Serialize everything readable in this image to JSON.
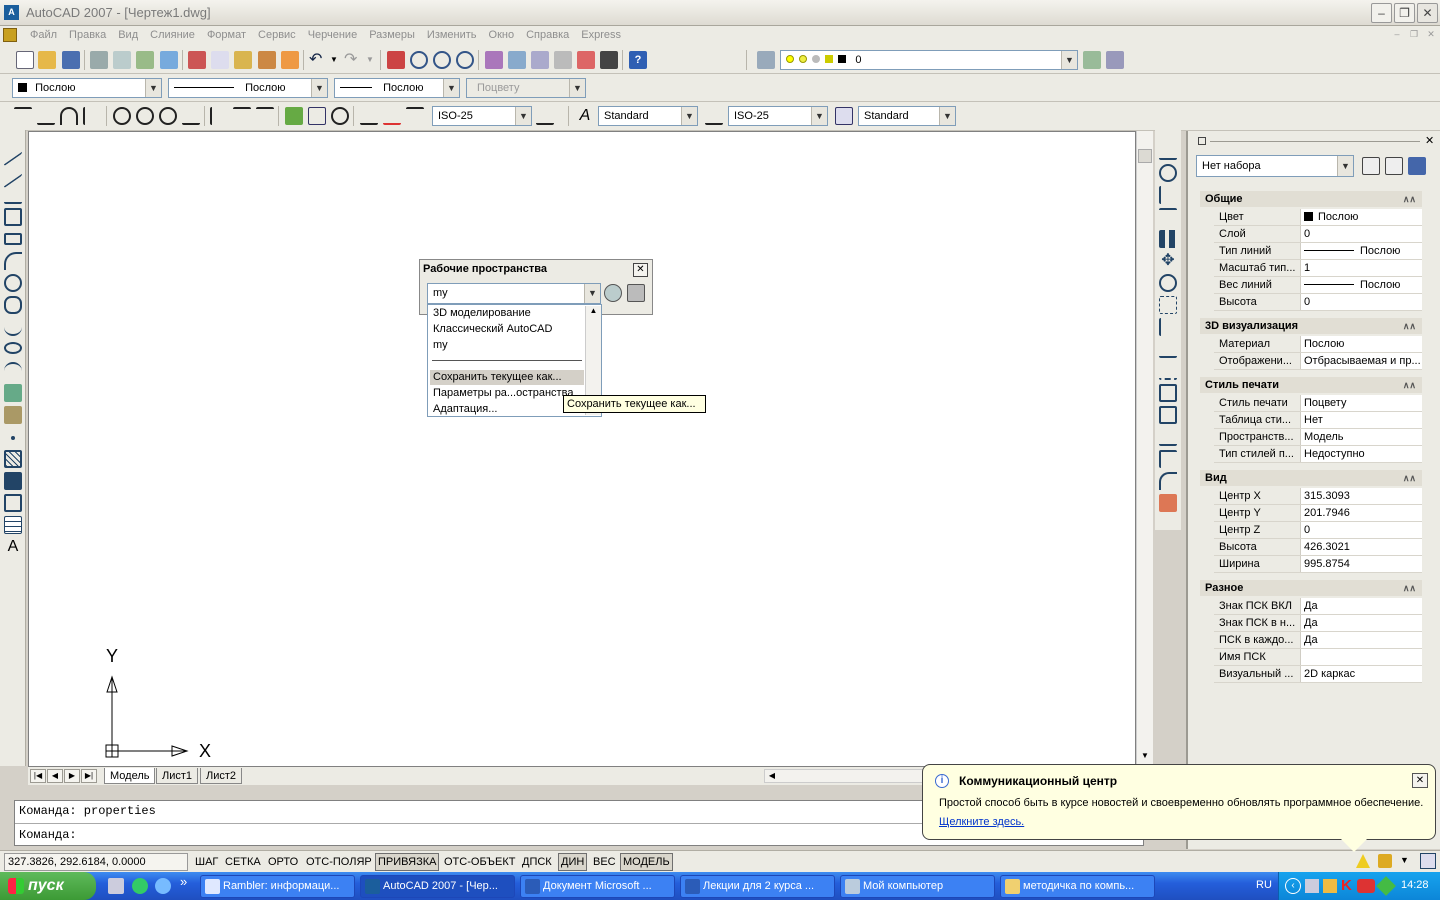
{
  "window": {
    "title": "AutoCAD 2007 - [Чертеж1.dwg]",
    "app_icon_text": "A"
  },
  "menu": [
    "Файл",
    "Правка",
    "Вид",
    "Слияние",
    "Формат",
    "Сервис",
    "Черчение",
    "Размеры",
    "Изменить",
    "Окно",
    "Справка",
    "Express"
  ],
  "layer_toolbar": {
    "current_layer": "0"
  },
  "properties_toolbar": {
    "color": "Послою",
    "linetype": "Послою",
    "lineweight": "Послою",
    "plotstyle": "Поцвету"
  },
  "styles_toolbar": {
    "dimstyle_left": "ISO-25",
    "textstyle": "Standard",
    "dimstyle": "ISO-25",
    "tablestyle": "Standard"
  },
  "workspaces": {
    "title": "Рабочие пространства",
    "current": "my",
    "items": [
      "3D моделирование",
      "Классический AutoCAD",
      "my",
      "Сохранить текущее как...",
      "Параметры ра...остранства",
      "Адаптация..."
    ],
    "highlighted_index": 3,
    "tooltip": "Сохранить текущее как..."
  },
  "ucs": {
    "y_label": "Y",
    "x_label": "X"
  },
  "layout_tabs": [
    "Модель",
    "Лист1",
    "Лист2"
  ],
  "command_line": {
    "line1": "Команда: properties",
    "line2": "Команда:"
  },
  "status": {
    "coords": "327.3826, 292.6184, 0.0000",
    "buttons": [
      {
        "label": "ШАГ",
        "on": false
      },
      {
        "label": "СЕТКА",
        "on": false
      },
      {
        "label": "ОРТО",
        "on": false
      },
      {
        "label": "ОТС-ПОЛЯР",
        "on": false
      },
      {
        "label": "ПРИВЯЗКА",
        "on": true
      },
      {
        "label": "ОТС-ОБЪЕКТ",
        "on": false
      },
      {
        "label": "ДПСК",
        "on": false
      },
      {
        "label": "ДИН",
        "on": true
      },
      {
        "label": "ВЕС",
        "on": false
      },
      {
        "label": "МОДЕЛЬ",
        "on": true
      }
    ]
  },
  "properties_palette": {
    "selection": "Нет набора",
    "sections": [
      {
        "title": "Общие",
        "rows": [
          {
            "label": "Цвет",
            "value": "Послою",
            "swatch": "#000000"
          },
          {
            "label": "Слой",
            "value": "0"
          },
          {
            "label": "Тип линий",
            "value": "Послою",
            "line": true
          },
          {
            "label": "Масштаб тип...",
            "value": "1"
          },
          {
            "label": "Вес линий",
            "value": "Послою",
            "line": true
          },
          {
            "label": "Высота",
            "value": "0"
          }
        ]
      },
      {
        "title": "3D визуализация",
        "rows": [
          {
            "label": "Материал",
            "value": "Послою"
          },
          {
            "label": "Отображени...",
            "value": "Отбрасываемая и пр..."
          }
        ]
      },
      {
        "title": "Стиль печати",
        "rows": [
          {
            "label": "Стиль печати",
            "value": "Поцвету"
          },
          {
            "label": "Таблица сти...",
            "value": "Нет"
          },
          {
            "label": "Пространств...",
            "value": "Модель"
          },
          {
            "label": "Тип стилей п...",
            "value": "Недоступно"
          }
        ]
      },
      {
        "title": "Вид",
        "rows": [
          {
            "label": "Центр X",
            "value": "315.3093"
          },
          {
            "label": "Центр Y",
            "value": "201.7946"
          },
          {
            "label": "Центр Z",
            "value": "0"
          },
          {
            "label": "Высота",
            "value": "426.3021"
          },
          {
            "label": "Ширина",
            "value": "995.8754"
          }
        ]
      },
      {
        "title": "Разное",
        "rows": [
          {
            "label": "Знак ПСК ВКЛ",
            "value": "Да"
          },
          {
            "label": "Знак ПСК в н...",
            "value": "Да"
          },
          {
            "label": "ПСК в каждо...",
            "value": "Да"
          },
          {
            "label": "Имя ПСК",
            "value": ""
          },
          {
            "label": "Визуальный ...",
            "value": "2D каркас"
          }
        ]
      }
    ]
  },
  "balloon": {
    "title": "Коммуникационный центр",
    "text": "Простой способ быть в курсе новостей и своевременно обновлять программное обеспечение.",
    "link": "Щелкните здесь."
  },
  "taskbar": {
    "start": "пуск",
    "tasks": [
      {
        "label": "Rambler: информаци...",
        "active": false
      },
      {
        "label": "AutoCAD 2007 - [Чер...",
        "active": true
      },
      {
        "label": "Документ Microsoft ...",
        "active": false
      },
      {
        "label": "Лекции для 2 курса ...",
        "active": false
      },
      {
        "label": "Мой компьютер",
        "active": false
      },
      {
        "label": "методичка по компь...",
        "active": false
      }
    ],
    "lang": "RU",
    "clock": "14:28",
    "more": "»"
  },
  "colors": {
    "selection": "#316ac5",
    "tooltip_bg": "#ffffe1",
    "taskbar": "#245edb",
    "start": "#3c9a35"
  }
}
